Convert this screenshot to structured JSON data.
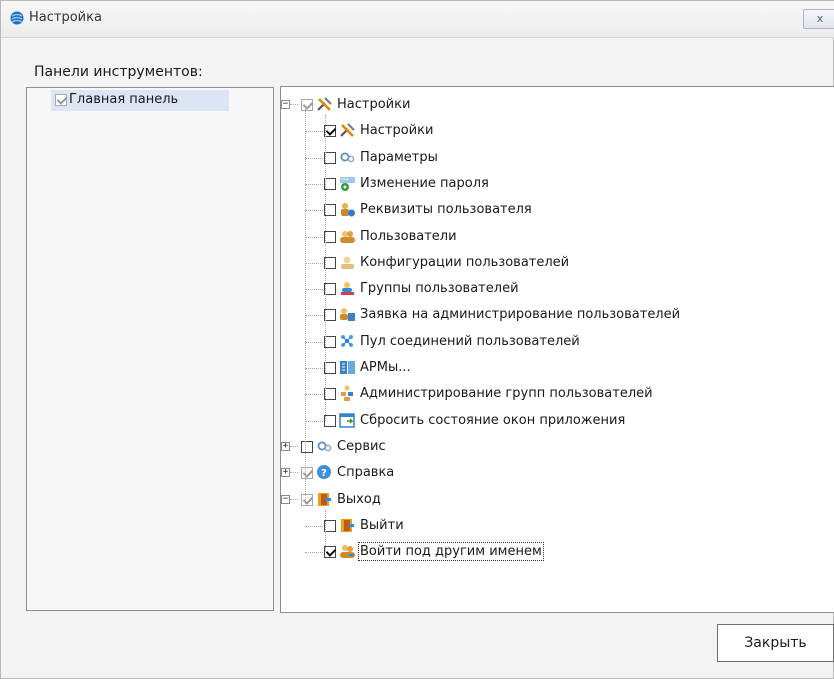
{
  "window": {
    "title": "Настройка",
    "close_glyph": "x"
  },
  "toolbar_panels": {
    "label": "Панели инструментов:",
    "items": [
      {
        "label": "Главная панель",
        "checked": true
      }
    ]
  },
  "tree": [
    {
      "label": "Настройки",
      "icon": "tools-icon",
      "checked": true,
      "grey": true,
      "level": 0,
      "expander": "minus"
    },
    {
      "label": "Настройки",
      "icon": "tools-icon",
      "checked": true,
      "level": 1
    },
    {
      "label": "Параметры",
      "icon": "gears-icon",
      "checked": false,
      "level": 1
    },
    {
      "label": "Изменение пароля",
      "icon": "password-icon",
      "checked": false,
      "level": 1
    },
    {
      "label": "Реквизиты пользователя",
      "icon": "user-info-icon",
      "checked": false,
      "level": 1
    },
    {
      "label": "Пользователи",
      "icon": "users-icon",
      "checked": false,
      "level": 1
    },
    {
      "label": "Конфигурации пользователей",
      "icon": "users-config-icon",
      "checked": false,
      "level": 1
    },
    {
      "label": "Группы пользователей",
      "icon": "user-groups-icon",
      "checked": false,
      "level": 1
    },
    {
      "label": "Заявка на администрирование пользователей",
      "icon": "admin-request-icon",
      "checked": false,
      "level": 1
    },
    {
      "label": "Пул соединений пользователей",
      "icon": "connection-pool-icon",
      "checked": false,
      "level": 1
    },
    {
      "label": "АРМы...",
      "icon": "workstations-icon",
      "checked": false,
      "level": 1
    },
    {
      "label": "Администрирование групп пользователей",
      "icon": "group-admin-icon",
      "checked": false,
      "level": 1
    },
    {
      "label": "Сбросить состояние окон приложения",
      "icon": "reset-windows-icon",
      "checked": false,
      "level": 1,
      "last": true
    },
    {
      "label": "Сервис",
      "icon": "gears-icon",
      "checked": false,
      "level": 0,
      "expander": "plus"
    },
    {
      "label": "Справка",
      "icon": "help-icon",
      "checked": true,
      "grey": true,
      "level": 0,
      "expander": "plus"
    },
    {
      "label": "Выход",
      "icon": "exit-icon",
      "checked": true,
      "grey": true,
      "level": 0,
      "expander": "minus"
    },
    {
      "label": "Выйти",
      "icon": "exit-icon",
      "checked": false,
      "level": 1
    },
    {
      "label": "Войти под другим именем",
      "icon": "switch-user-icon",
      "checked": true,
      "level": 1,
      "last": true,
      "focused": true
    }
  ],
  "buttons": {
    "close": "Закрыть"
  },
  "colors": {
    "selection": "#dbe5f3",
    "window_bg": "#f3f3f3",
    "accent": "#2b7bd8"
  }
}
